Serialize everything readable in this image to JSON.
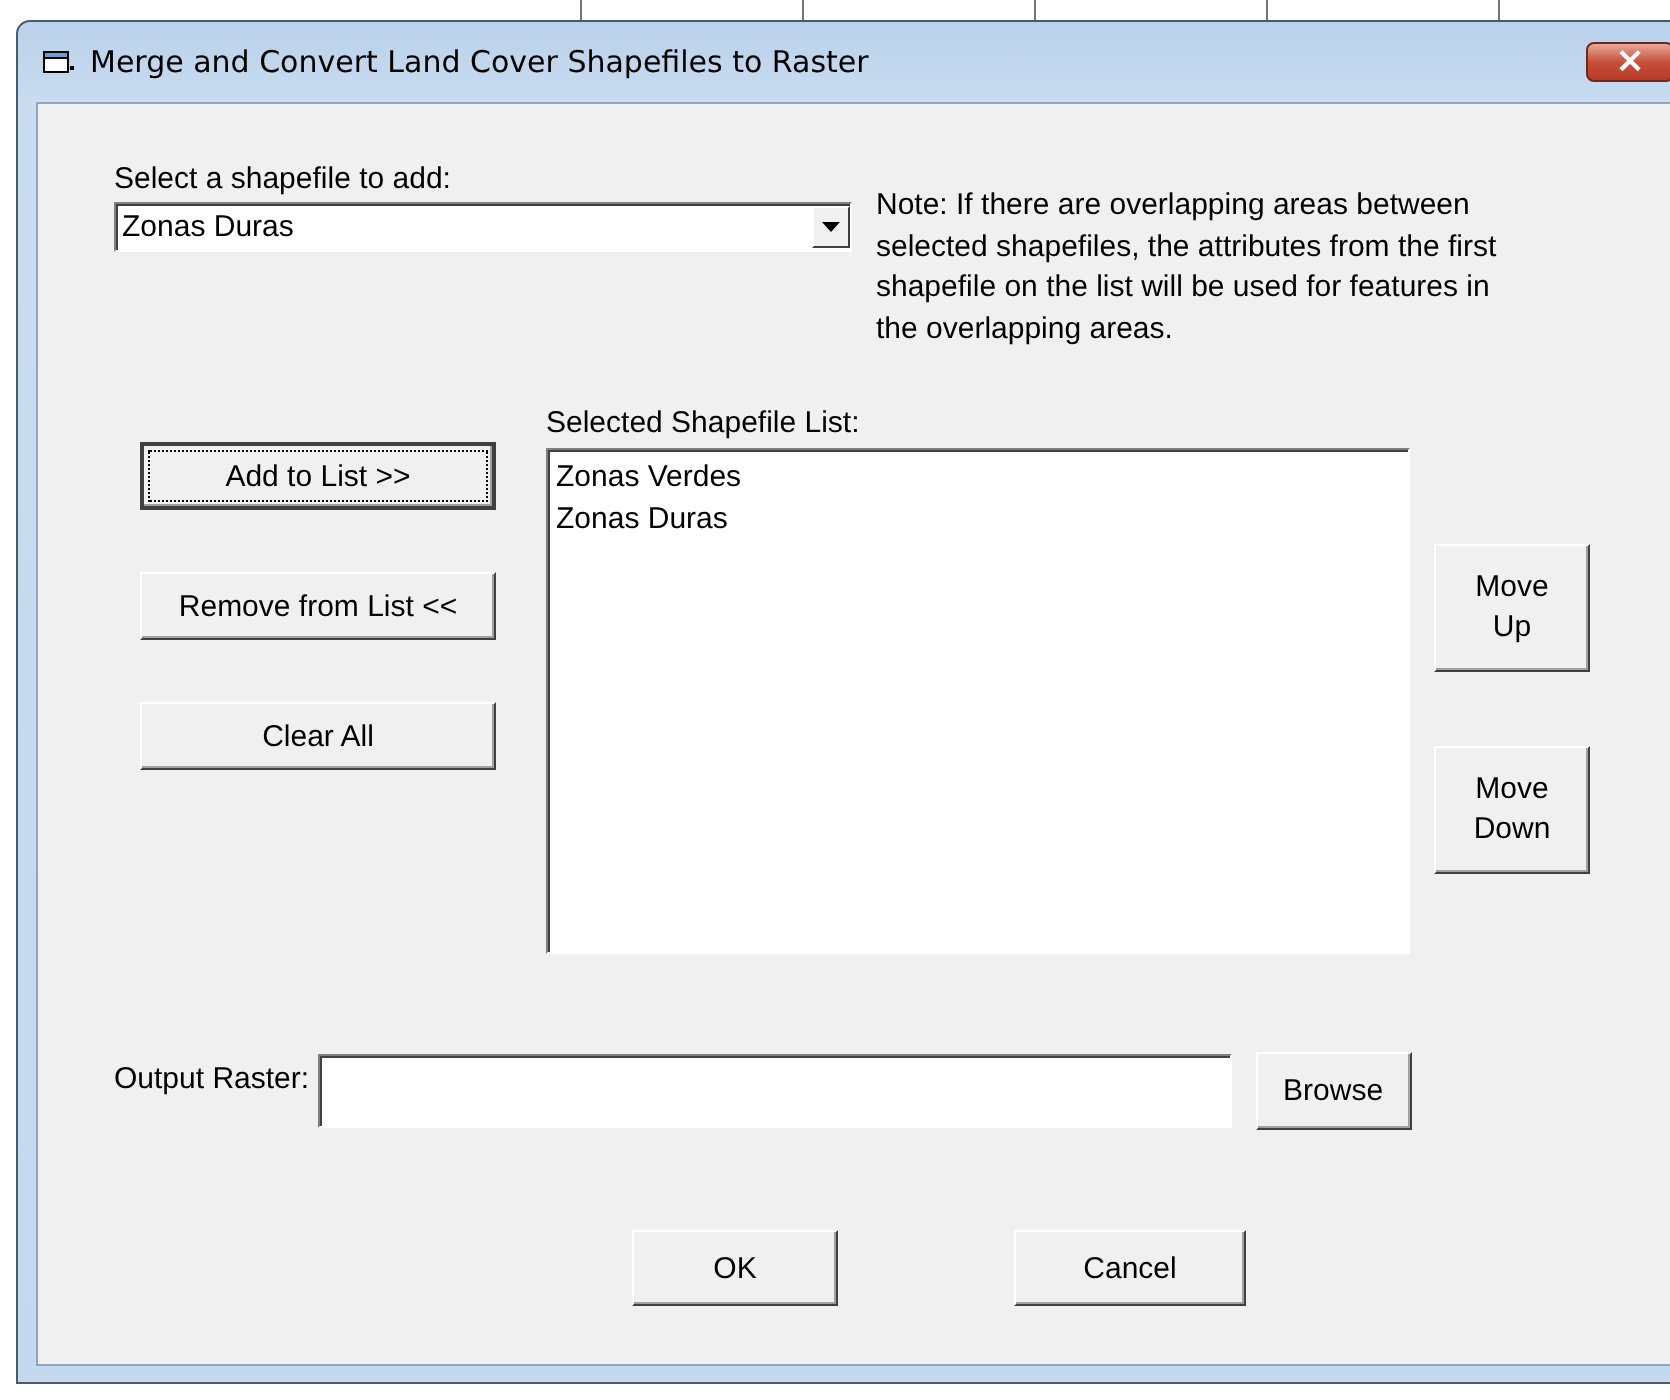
{
  "window": {
    "title": "Merge and Convert Land Cover Shapefiles to Raster",
    "close": "×"
  },
  "shapefile_select": {
    "label": "Select a shapefile to add:",
    "value": "Zonas Duras"
  },
  "note": "Note: If there are overlapping areas between selected shapefiles, the attributes from the first shapefile on the list will be used for features in the overlapping areas.",
  "list_buttons": [
    {
      "label": "Add to List >>",
      "focused": true
    },
    {
      "label": "Remove from List <<",
      "focused": false
    },
    {
      "label": "Clear All",
      "focused": false
    }
  ],
  "selected_list": {
    "label": "Selected Shapefile List:",
    "items": [
      "Zonas Verdes",
      "Zonas Duras"
    ]
  },
  "move_buttons": [
    {
      "label": "Move Up"
    },
    {
      "label": "Move Down"
    }
  ],
  "output": {
    "label": "Output Raster:",
    "browse": "Browse"
  },
  "buttons": [
    "OK",
    "Cancel"
  ]
}
